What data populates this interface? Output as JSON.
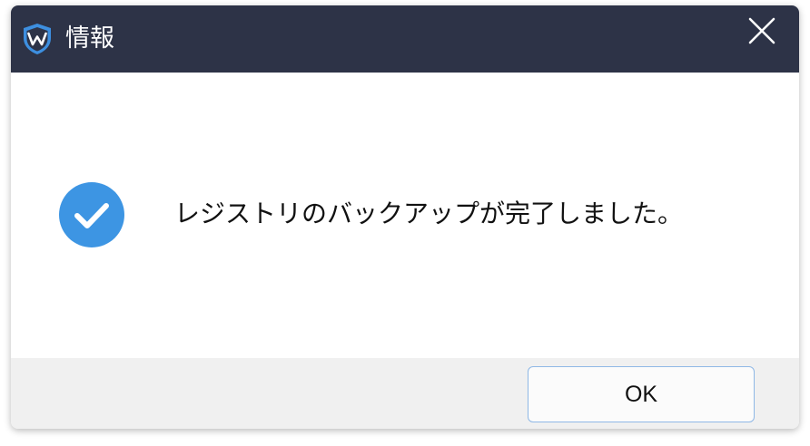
{
  "window": {
    "title": "情報",
    "app_icon": "shield-icon",
    "close_icon": "close-icon"
  },
  "content": {
    "status_icon": "check-circle-icon",
    "message": "レジストリのバックアップが完了しました。"
  },
  "footer": {
    "ok_label": "OK"
  },
  "colors": {
    "titlebar": "#2d3347",
    "accent": "#3d95e3",
    "footer": "#f0f0f0",
    "button_border": "#8fb8e6"
  }
}
